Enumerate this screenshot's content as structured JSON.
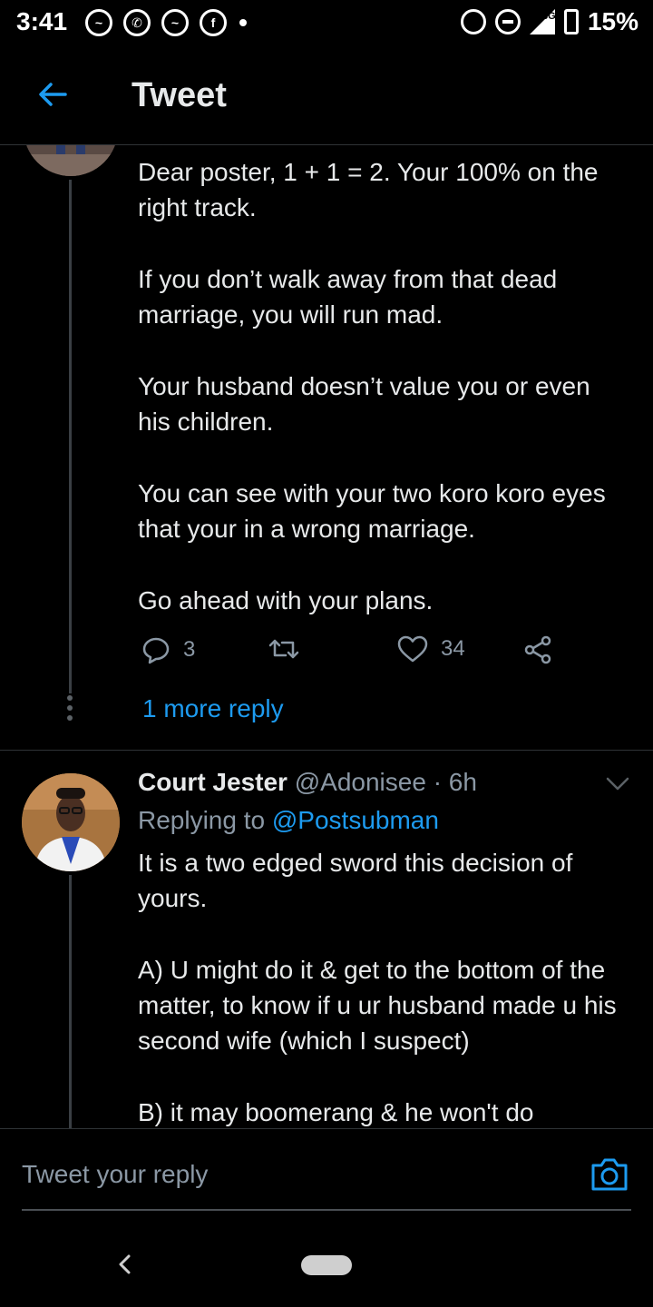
{
  "status_bar": {
    "time": "3:41",
    "notification_icons": [
      "messenger-icon",
      "whatsapp-icon",
      "messenger-icon",
      "facebook-icon"
    ],
    "network_label": "3G",
    "battery": "15%"
  },
  "header": {
    "title": "Tweet",
    "back_icon": "arrow-left-icon",
    "accent_color": "#1d9bf0"
  },
  "tweet1": {
    "paragraphs": [
      "Dear poster, 1 + 1 = 2. Your 100% on the right track.",
      "If you don’t walk away from that dead marriage, you will run mad.",
      "Your husband doesn’t value you or even his children.",
      "You can see with your two koro koro eyes that your in a wrong marriage.",
      "Go ahead with your plans."
    ],
    "reply_count": "3",
    "like_count": "34",
    "more_replies": "1 more reply"
  },
  "tweet2": {
    "name": "Court Jester",
    "handle": "@Adonisee",
    "time": "· 6h",
    "replying_prefix": "Replying to",
    "replying_to": "@Postsubman",
    "paragraphs": [
      "It is a two edged sword this decision of yours.",
      "A) U might do it & get to the bottom of the matter, to know if u ur husband made u his second wife (which I suspect)",
      "B) it may boomerang & he won't do"
    ]
  },
  "reply_bar": {
    "placeholder": "Tweet your reply",
    "camera_icon": "camera-icon"
  }
}
